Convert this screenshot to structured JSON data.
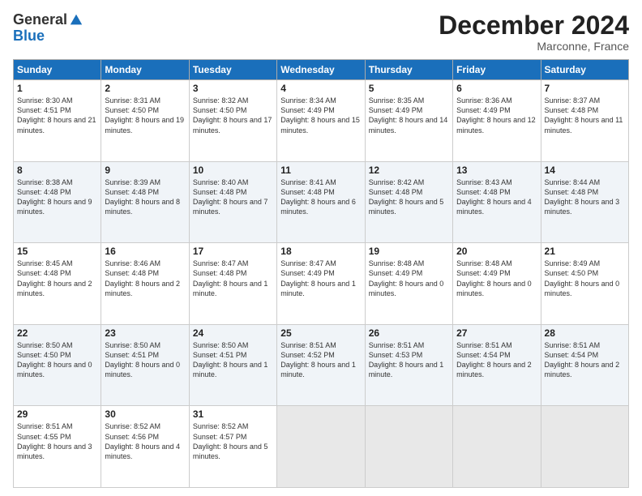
{
  "header": {
    "logo_general": "General",
    "logo_blue": "Blue",
    "month_title": "December 2024",
    "location": "Marconne, France"
  },
  "days_of_week": [
    "Sunday",
    "Monday",
    "Tuesday",
    "Wednesday",
    "Thursday",
    "Friday",
    "Saturday"
  ],
  "weeks": [
    [
      {
        "day": "1",
        "sunrise": "8:30 AM",
        "sunset": "4:51 PM",
        "daylight": "8 hours and 21 minutes."
      },
      {
        "day": "2",
        "sunrise": "8:31 AM",
        "sunset": "4:50 PM",
        "daylight": "8 hours and 19 minutes."
      },
      {
        "day": "3",
        "sunrise": "8:32 AM",
        "sunset": "4:50 PM",
        "daylight": "8 hours and 17 minutes."
      },
      {
        "day": "4",
        "sunrise": "8:34 AM",
        "sunset": "4:49 PM",
        "daylight": "8 hours and 15 minutes."
      },
      {
        "day": "5",
        "sunrise": "8:35 AM",
        "sunset": "4:49 PM",
        "daylight": "8 hours and 14 minutes."
      },
      {
        "day": "6",
        "sunrise": "8:36 AM",
        "sunset": "4:49 PM",
        "daylight": "8 hours and 12 minutes."
      },
      {
        "day": "7",
        "sunrise": "8:37 AM",
        "sunset": "4:48 PM",
        "daylight": "8 hours and 11 minutes."
      }
    ],
    [
      {
        "day": "8",
        "sunrise": "8:38 AM",
        "sunset": "4:48 PM",
        "daylight": "8 hours and 9 minutes."
      },
      {
        "day": "9",
        "sunrise": "8:39 AM",
        "sunset": "4:48 PM",
        "daylight": "8 hours and 8 minutes."
      },
      {
        "day": "10",
        "sunrise": "8:40 AM",
        "sunset": "4:48 PM",
        "daylight": "8 hours and 7 minutes."
      },
      {
        "day": "11",
        "sunrise": "8:41 AM",
        "sunset": "4:48 PM",
        "daylight": "8 hours and 6 minutes."
      },
      {
        "day": "12",
        "sunrise": "8:42 AM",
        "sunset": "4:48 PM",
        "daylight": "8 hours and 5 minutes."
      },
      {
        "day": "13",
        "sunrise": "8:43 AM",
        "sunset": "4:48 PM",
        "daylight": "8 hours and 4 minutes."
      },
      {
        "day": "14",
        "sunrise": "8:44 AM",
        "sunset": "4:48 PM",
        "daylight": "8 hours and 3 minutes."
      }
    ],
    [
      {
        "day": "15",
        "sunrise": "8:45 AM",
        "sunset": "4:48 PM",
        "daylight": "8 hours and 2 minutes."
      },
      {
        "day": "16",
        "sunrise": "8:46 AM",
        "sunset": "4:48 PM",
        "daylight": "8 hours and 2 minutes."
      },
      {
        "day": "17",
        "sunrise": "8:47 AM",
        "sunset": "4:48 PM",
        "daylight": "8 hours and 1 minute."
      },
      {
        "day": "18",
        "sunrise": "8:47 AM",
        "sunset": "4:49 PM",
        "daylight": "8 hours and 1 minute."
      },
      {
        "day": "19",
        "sunrise": "8:48 AM",
        "sunset": "4:49 PM",
        "daylight": "8 hours and 0 minutes."
      },
      {
        "day": "20",
        "sunrise": "8:48 AM",
        "sunset": "4:49 PM",
        "daylight": "8 hours and 0 minutes."
      },
      {
        "day": "21",
        "sunrise": "8:49 AM",
        "sunset": "4:50 PM",
        "daylight": "8 hours and 0 minutes."
      }
    ],
    [
      {
        "day": "22",
        "sunrise": "8:50 AM",
        "sunset": "4:50 PM",
        "daylight": "8 hours and 0 minutes."
      },
      {
        "day": "23",
        "sunrise": "8:50 AM",
        "sunset": "4:51 PM",
        "daylight": "8 hours and 0 minutes."
      },
      {
        "day": "24",
        "sunrise": "8:50 AM",
        "sunset": "4:51 PM",
        "daylight": "8 hours and 1 minute."
      },
      {
        "day": "25",
        "sunrise": "8:51 AM",
        "sunset": "4:52 PM",
        "daylight": "8 hours and 1 minute."
      },
      {
        "day": "26",
        "sunrise": "8:51 AM",
        "sunset": "4:53 PM",
        "daylight": "8 hours and 1 minute."
      },
      {
        "day": "27",
        "sunrise": "8:51 AM",
        "sunset": "4:54 PM",
        "daylight": "8 hours and 2 minutes."
      },
      {
        "day": "28",
        "sunrise": "8:51 AM",
        "sunset": "4:54 PM",
        "daylight": "8 hours and 2 minutes."
      }
    ],
    [
      {
        "day": "29",
        "sunrise": "8:51 AM",
        "sunset": "4:55 PM",
        "daylight": "8 hours and 3 minutes."
      },
      {
        "day": "30",
        "sunrise": "8:52 AM",
        "sunset": "4:56 PM",
        "daylight": "8 hours and 4 minutes."
      },
      {
        "day": "31",
        "sunrise": "8:52 AM",
        "sunset": "4:57 PM",
        "daylight": "8 hours and 5 minutes."
      },
      null,
      null,
      null,
      null
    ]
  ],
  "labels": {
    "sunrise": "Sunrise:",
    "sunset": "Sunset:",
    "daylight": "Daylight:"
  }
}
